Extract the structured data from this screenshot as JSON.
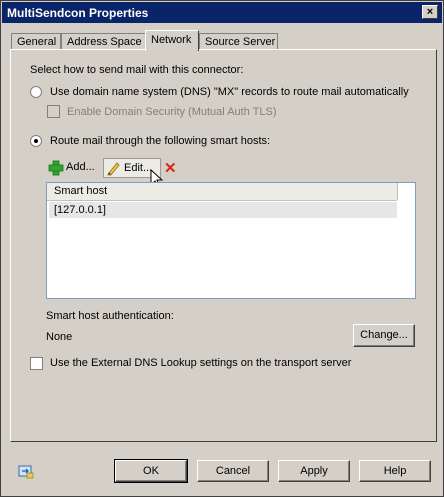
{
  "window": {
    "title": "MultiSendcon Properties",
    "close_glyph": "×"
  },
  "tabs": [
    {
      "label": "General"
    },
    {
      "label": "Address Space"
    },
    {
      "label": "Network"
    },
    {
      "label": "Source Server"
    }
  ],
  "network": {
    "instruction": "Select how to send mail with this connector:",
    "dns_option": {
      "label": "Use domain name system (DNS) \"MX\" records to route mail automatically",
      "selected": false
    },
    "domain_security": {
      "label": "Enable Domain Security (Mutual Auth TLS)",
      "checked": false,
      "disabled": true
    },
    "smarthost_option": {
      "label": "Route mail through the following smart hosts:",
      "selected": true
    },
    "toolbar": {
      "add_label": "Add...",
      "edit_label": "Edit...",
      "remove_glyph": "✕"
    },
    "smart_host_list": {
      "column_header": "Smart host",
      "rows": [
        "[127.0.0.1]"
      ]
    },
    "auth_label": "Smart host authentication:",
    "auth_value": "None",
    "change_button": "Change...",
    "external_dns": {
      "label": "Use the External DNS Lookup settings on the transport server",
      "checked": false
    }
  },
  "footer": {
    "ok": "OK",
    "cancel": "Cancel",
    "apply": "Apply",
    "help": "Help"
  },
  "colors": {
    "title_bar": "#0a246a",
    "dialog_bg": "#d4d0c8",
    "add_icon": "#2fa82f",
    "remove_icon": "#d9261c"
  }
}
